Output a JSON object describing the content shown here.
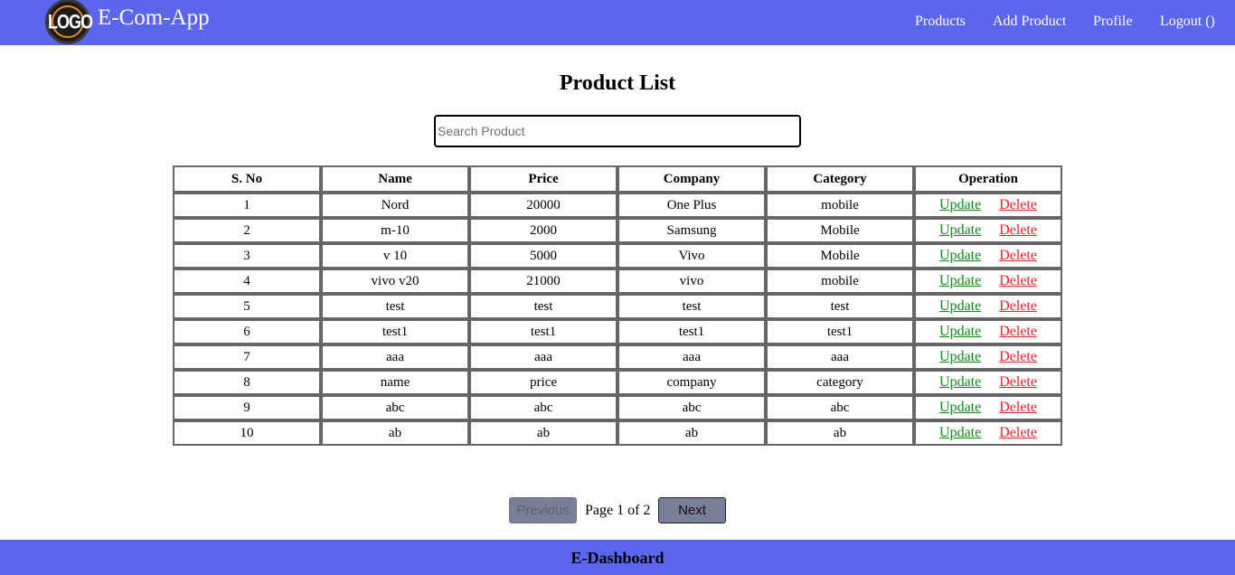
{
  "header": {
    "logo_text": "LOGO",
    "app_title": "E-Com-App",
    "nav": [
      "Products",
      "Add Product",
      "Profile",
      "Logout ()"
    ]
  },
  "main": {
    "title": "Product List",
    "search_placeholder": "Search Product",
    "table": {
      "columns": [
        "S. No",
        "Name",
        "Price",
        "Company",
        "Category",
        "Operation"
      ],
      "rows": [
        [
          "1",
          "Nord",
          "20000",
          "One Plus",
          "mobile"
        ],
        [
          "2",
          "m-10",
          "2000",
          "Samsung",
          "Mobile"
        ],
        [
          "3",
          "v 10",
          "5000",
          "Vivo",
          "Mobile"
        ],
        [
          "4",
          "vivo v20",
          "21000",
          "vivo",
          "mobile"
        ],
        [
          "5",
          "test",
          "test",
          "test",
          "test"
        ],
        [
          "6",
          "test1",
          "test1",
          "test1",
          "test1"
        ],
        [
          "7",
          "aaa",
          "aaa",
          "aaa",
          "aaa"
        ],
        [
          "8",
          "name",
          "price",
          "company",
          "category"
        ],
        [
          "9",
          "abc",
          "abc",
          "abc",
          "abc"
        ],
        [
          "10",
          "ab",
          "ab",
          "ab",
          "ab"
        ]
      ],
      "update_label": "Update",
      "delete_label": "Delete"
    }
  },
  "pagination": {
    "previous_label": "Previous",
    "page_info": "Page 1 of 2",
    "next_label": "Next"
  },
  "footer": {
    "text": "E-Dashboard"
  },
  "colors": {
    "navbar": "#5b66ec",
    "update_link": "#11881b",
    "delete_link": "#e5242a",
    "button_bg": "#7a7f98"
  }
}
